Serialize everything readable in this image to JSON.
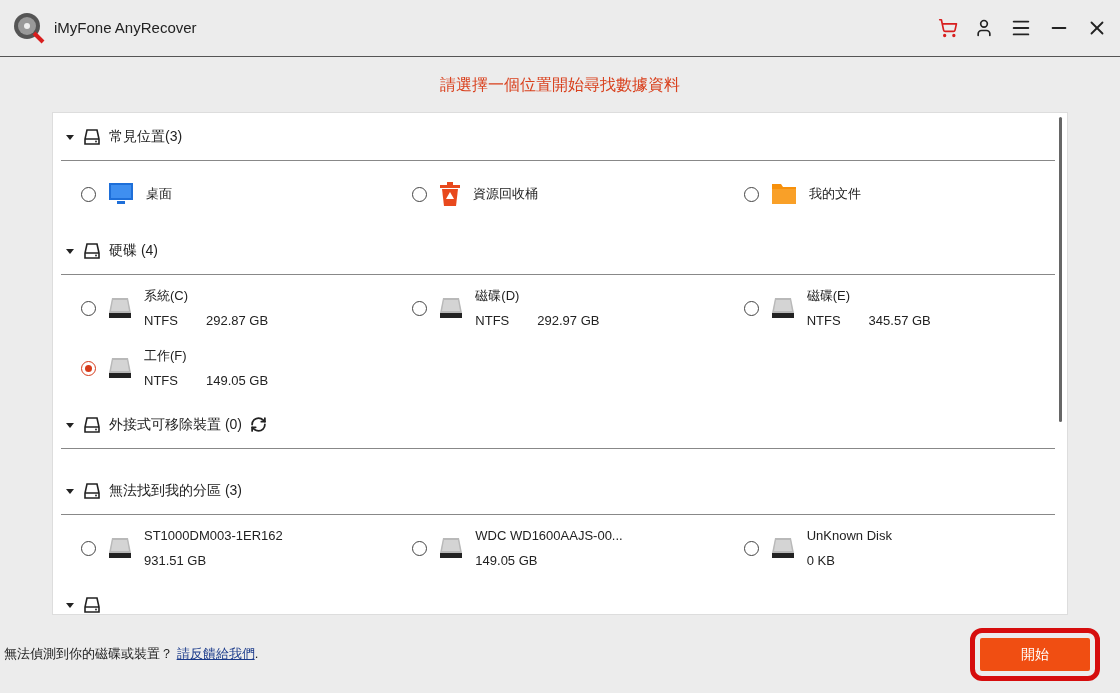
{
  "window": {
    "title": "iMyFone AnyRecover"
  },
  "heading": "請選擇一個位置開始尋找數據資料",
  "sections": [
    {
      "title": "常見位置(3)",
      "expanded": true,
      "items": [
        {
          "kind": "desktop",
          "name": "桌面",
          "selected": false
        },
        {
          "kind": "trash",
          "name": "資源回收桶",
          "selected": false
        },
        {
          "kind": "folder",
          "name": "我的文件",
          "selected": false
        }
      ]
    },
    {
      "title": "硬碟 (4)",
      "expanded": true,
      "items": [
        {
          "kind": "drive",
          "name": "系統(C)",
          "fs": "NTFS",
          "size": "292.87 GB",
          "selected": false
        },
        {
          "kind": "drive",
          "name": "磁碟(D)",
          "fs": "NTFS",
          "size": "292.97 GB",
          "selected": false
        },
        {
          "kind": "drive",
          "name": "磁碟(E)",
          "fs": "NTFS",
          "size": "345.57 GB",
          "selected": false
        },
        {
          "kind": "drive",
          "name": "工作(F)",
          "fs": "NTFS",
          "size": "149.05 GB",
          "selected": true
        }
      ]
    },
    {
      "title": "外接式可移除裝置 (0)",
      "expanded": true,
      "refresh": true
    },
    {
      "title": "無法找到我的分區 (3)",
      "expanded": true,
      "items": [
        {
          "kind": "drive",
          "name": "ST1000DM003-1ER162",
          "size": "931.51 GB",
          "selected": false
        },
        {
          "kind": "drive",
          "name": "WDC WD1600AAJS-00...",
          "size": "149.05 GB",
          "selected": false
        },
        {
          "kind": "drive",
          "name": "UnKnown Disk",
          "size": "0 KB",
          "selected": false
        }
      ]
    },
    {
      "expanded": true
    }
  ],
  "footer": {
    "question": "無法偵測到你的磁碟或裝置？",
    "link": "請反饋給我們",
    "link_suffix": "."
  },
  "start_button": {
    "label": "開始",
    "highlighted": true
  }
}
